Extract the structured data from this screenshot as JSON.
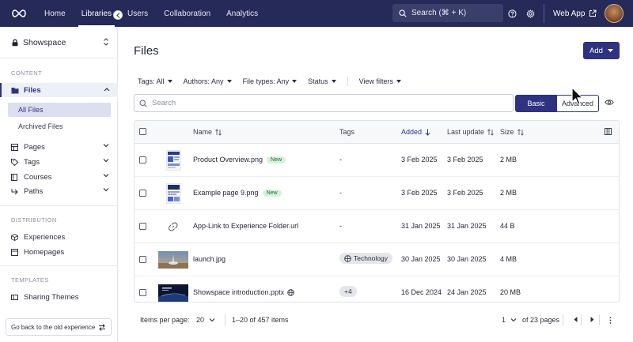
{
  "topbar": {
    "nav": [
      "Home",
      "Libraries",
      "Users",
      "Collaboration",
      "Analytics"
    ],
    "active_nav": "Libraries",
    "search_label": "Search (⌘ + K)",
    "web_app_label": "Web App",
    "icons": [
      "logo-icon",
      "search-icon",
      "help-icon",
      "gear-icon",
      "external-link-icon",
      "avatar"
    ]
  },
  "sidebar": {
    "workspace": "Showspace",
    "content_section": "CONTENT",
    "files_label": "Files",
    "files_sub": [
      "All Files",
      "Archived Files"
    ],
    "content_items": [
      "Pages",
      "Tags",
      "Courses",
      "Paths"
    ],
    "distribution_section": "DISTRIBUTION",
    "distribution_items": [
      "Experiences",
      "Homepages"
    ],
    "templates_section": "TEMPLATES",
    "templates_items": [
      "Sharing Themes"
    ],
    "go_back": "Go back to the old experience"
  },
  "main": {
    "title": "Files",
    "add_label": "Add",
    "filters": [
      "Tags: All",
      "Authors: Any",
      "File types: Any",
      "Status"
    ],
    "view_filters": "View filters",
    "search_placeholder": "Search",
    "mode_basic": "Basic",
    "mode_advanced": "Advanced"
  },
  "table": {
    "headers": {
      "name": "Name",
      "tags": "Tags",
      "added": "Added",
      "last_update": "Last update",
      "size": "Size"
    },
    "rows": [
      {
        "name": "Product Overview.png",
        "badge": "New",
        "tags": "-",
        "added": "3 Feb 2025",
        "updated": "3 Feb 2025",
        "size": "2 MB"
      },
      {
        "name": "Example page 9.png",
        "badge": "New",
        "tags": "-",
        "added": "3 Feb 2025",
        "updated": "3 Feb 2025",
        "size": "2 MB"
      },
      {
        "name": "App-Link to Experience Folder.url",
        "badge": "",
        "tags": "-",
        "added": "31 Jan 2025",
        "updated": "31 Jan 2025",
        "size": "44 B"
      },
      {
        "name": "launch.jpg",
        "badge": "",
        "tags": "Technology",
        "added": "30 Jan 2025",
        "updated": "30 Jan 2025",
        "size": "4 MB"
      },
      {
        "name": "Showspace introduction.pptx",
        "badge": "",
        "tags": "+4",
        "added": "16 Dec 2024",
        "updated": "24 Jan 2025",
        "size": "20 MB"
      }
    ]
  },
  "pager": {
    "items_per_page_label": "Items per page:",
    "items_per_page": "20",
    "range": "1–20 of 457 items",
    "page": "1",
    "of_pages": "of 23 pages"
  },
  "colors": {
    "topbar": "#262a58",
    "accent": "#2e3280",
    "new_badge_bg": "#d7f1dc"
  }
}
